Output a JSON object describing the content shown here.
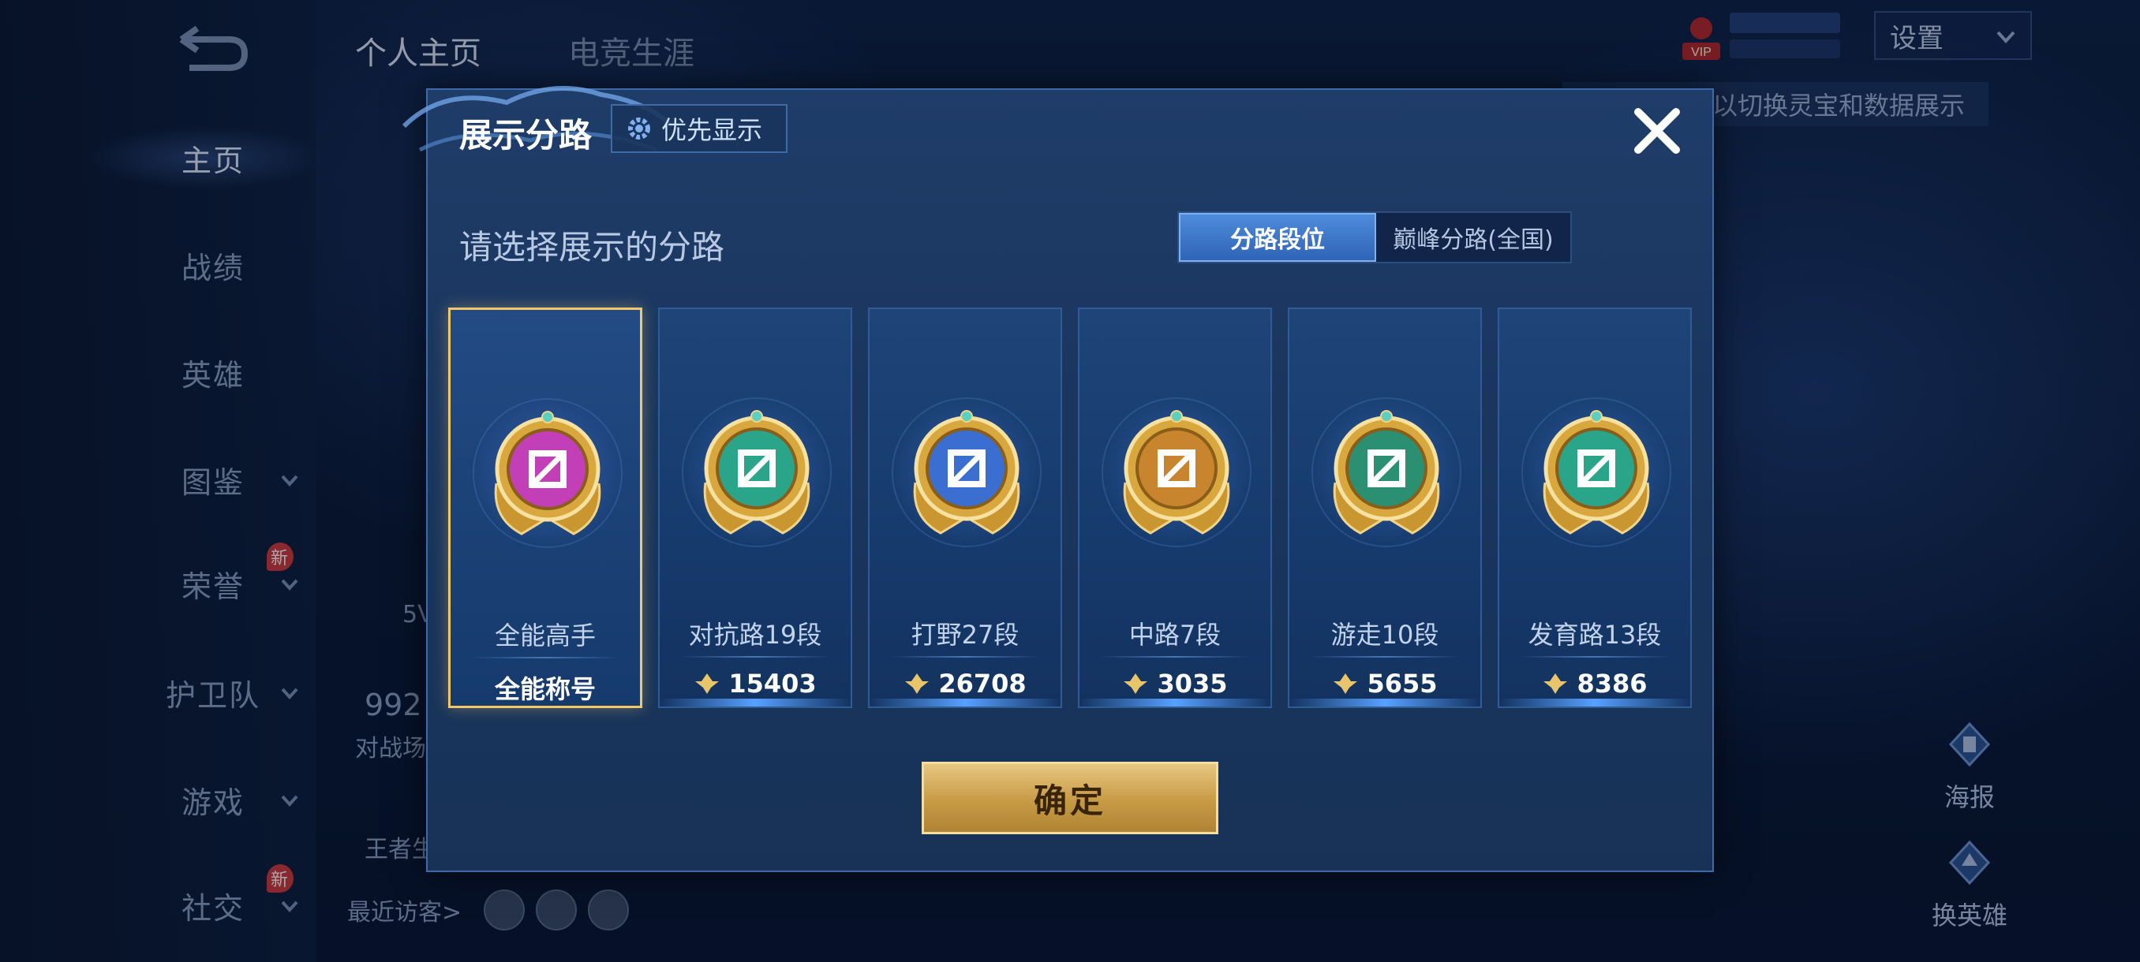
{
  "nav": {
    "items": [
      {
        "label": "主页",
        "active": true,
        "chevron": false,
        "new": false
      },
      {
        "label": "战绩",
        "active": false,
        "chevron": false,
        "new": false
      },
      {
        "label": "英雄",
        "active": false,
        "chevron": false,
        "new": false
      },
      {
        "label": "图鉴",
        "active": false,
        "chevron": true,
        "new": false
      },
      {
        "label": "荣誉",
        "active": false,
        "chevron": true,
        "new": true
      },
      {
        "label": "护卫队",
        "active": false,
        "chevron": true,
        "new": false
      },
      {
        "label": "游戏",
        "active": false,
        "chevron": true,
        "new": false
      },
      {
        "label": "社交",
        "active": false,
        "chevron": true,
        "new": true
      }
    ],
    "new_badge": "新"
  },
  "top_tabs": [
    "个人主页",
    "电竞生涯"
  ],
  "header": {
    "settings_label": "设置",
    "hint_text": "以切换灵宝和数据展示",
    "vip_label": "VIP"
  },
  "background": {
    "partial_number": "992",
    "partial_text_1": "对战场",
    "partial_text_2": "王者生",
    "partial_text_3": "5V",
    "visitors_label": "最近访客>"
  },
  "side_buttons": [
    {
      "label": "海报"
    },
    {
      "label": "换英雄"
    }
  ],
  "modal": {
    "title": "展示分路",
    "priority_label": "优先显示",
    "subtitle": "请选择展示的分路",
    "segments": [
      "分路段位",
      "巅峰分路(全国)"
    ],
    "active_segment": 0,
    "confirm_label": "确定",
    "cards": [
      {
        "name": "全能高手",
        "score": "全能称号",
        "selected": true,
        "emblem": "all-round-emblem-icon",
        "color": "#c23fb8"
      },
      {
        "name": "对抗路19段",
        "score": "15403",
        "selected": false,
        "emblem": "clash-lane-emblem-icon",
        "color": "#2aa58a"
      },
      {
        "name": "打野27段",
        "score": "26708",
        "selected": false,
        "emblem": "jungle-emblem-icon",
        "color": "#3a6ed0"
      },
      {
        "name": "中路7段",
        "score": "3035",
        "selected": false,
        "emblem": "mid-lane-emblem-icon",
        "color": "#c8852e"
      },
      {
        "name": "游走10段",
        "score": "5655",
        "selected": false,
        "emblem": "roam-emblem-icon",
        "color": "#2b8f72"
      },
      {
        "name": "发育路13段",
        "score": "8386",
        "selected": false,
        "emblem": "farm-lane-emblem-icon",
        "color": "#2aa58a"
      }
    ]
  },
  "colors": {
    "gold": "#f0c86a",
    "accent_blue": "#4f8bdc",
    "panel": "#1f3d69"
  }
}
